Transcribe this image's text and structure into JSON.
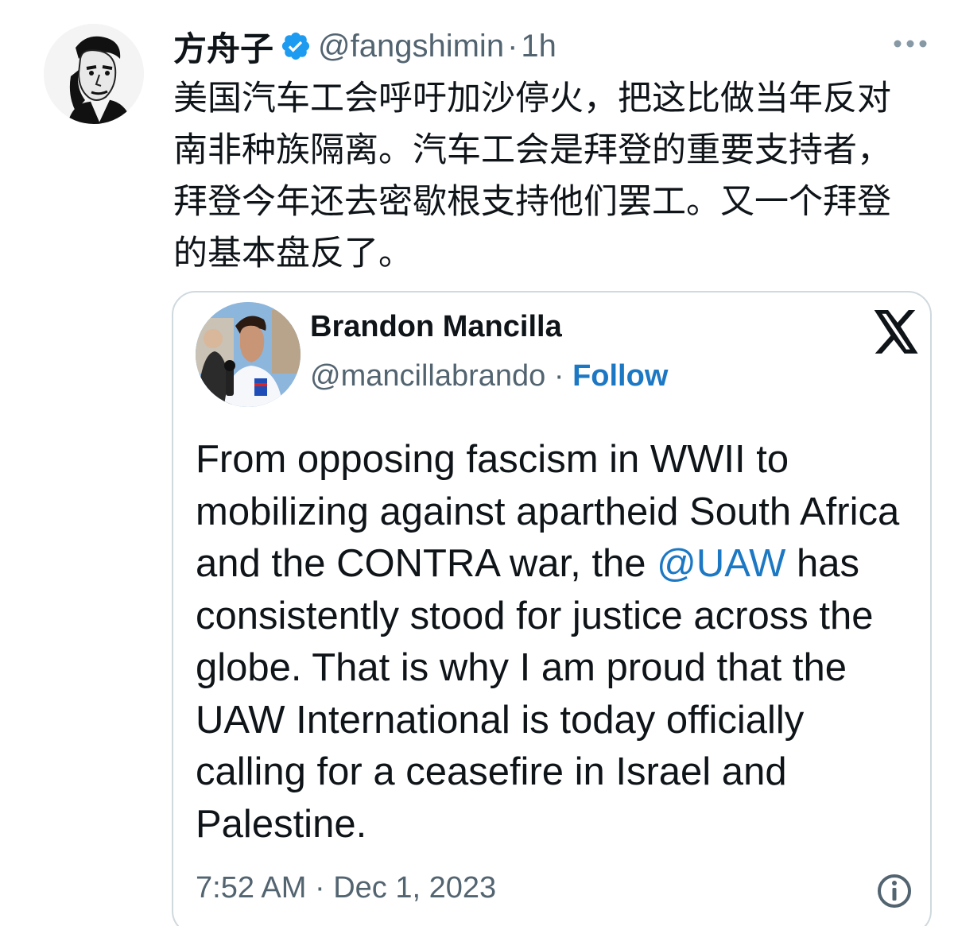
{
  "tweet": {
    "author_name": "方舟子",
    "handle": "@fangshimin",
    "separator": "·",
    "time": "1h",
    "text": "美国汽车工会呼吁加沙停火，把这比做当年反对南非种族隔离。汽车工会是拜登的重要支持者，拜登今年还去密歇根支持他们罢工。又一个拜登的基本盘反了。",
    "more_icon": "more-horizontal-icon",
    "verified_icon": "verified-badge-icon"
  },
  "embedded": {
    "author_name": "Brandon Mancilla",
    "handle": "@mancillabrando",
    "separator": "·",
    "follow_label": "Follow",
    "logo_icon": "x-logo-icon",
    "text_before_mention": "From opposing fascism in WWII to mobilizing against apartheid South Africa and the CONTRA war, the ",
    "mention": "@UAW",
    "text_after_mention": " has consistently stood for justice across the globe. That is why I am proud that the UAW International is today officially calling for a ceasefire in Israel and Palestine.",
    "timestamp": "7:52 AM · Dec 1, 2023",
    "info_icon": "info-icon"
  },
  "colors": {
    "link": "#1d78c4",
    "verified": "#1d9bf0",
    "secondary_text": "#536471",
    "border": "#cfd9de"
  }
}
